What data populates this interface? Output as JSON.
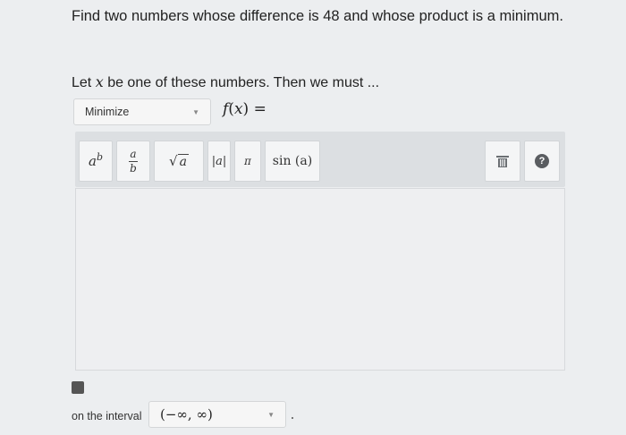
{
  "problem": {
    "statement": "Find two numbers whose difference is 48 and whose product is a minimum.",
    "let_prefix": "Let",
    "let_variable": "x",
    "let_suffix": "be one of these numbers. Then we must ..."
  },
  "objective_select": {
    "value": "Minimize",
    "caret_icon": "chevron-down-icon"
  },
  "function_label": {
    "f": "f",
    "open": "(",
    "x": "x",
    "close": ") ="
  },
  "toolbar": {
    "buttons": [
      {
        "name": "exponent",
        "base": "a",
        "sup": "b"
      },
      {
        "name": "fraction",
        "num": "a",
        "den": "b"
      },
      {
        "name": "sqrt",
        "symbol": "√",
        "arg": "a"
      },
      {
        "name": "abs",
        "label": "|a|"
      },
      {
        "name": "pi",
        "label": "π"
      },
      {
        "name": "sin",
        "label": "sin (a)"
      }
    ],
    "trash_icon": "trash-icon",
    "help_icon": "help-icon",
    "help_glyph": "?"
  },
  "interval": {
    "label": "on the interval",
    "value": "(−∞, ∞)"
  }
}
